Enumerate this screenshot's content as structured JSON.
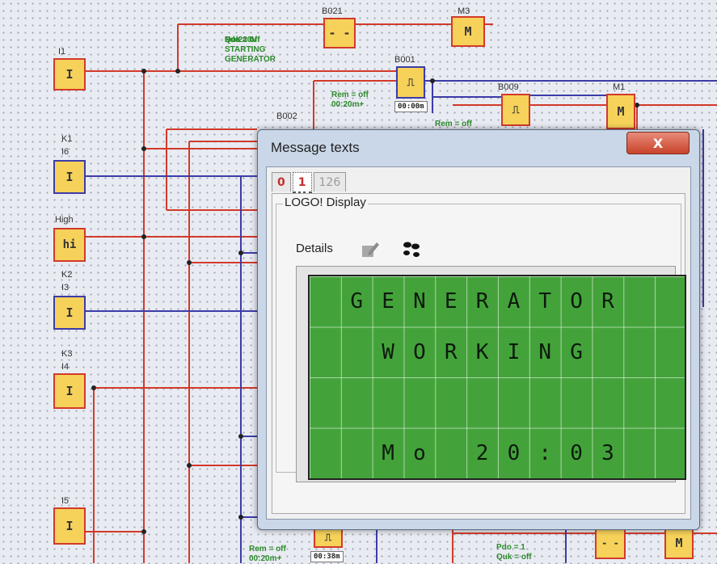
{
  "diagram": {
    "block_labels": {
      "b021": "B021",
      "m3": "M3",
      "b001": "B001",
      "b002": "B002",
      "b009": "B009",
      "m1": "M1",
      "i1": "I1",
      "k1": "K1",
      "i6": "I6",
      "high": "High",
      "k2": "K2",
      "i3": "I3",
      "k3": "K3",
      "i4": "I4",
      "i5": "I5"
    },
    "block_symbols": {
      "input": "I",
      "hi": "hi",
      "marker": "M",
      "and": "- -",
      "timer": "⎍"
    },
    "green_texts": [
      "Pdo = 0",
      "Quk = off",
      "No:220V",
      "STARTING",
      "GENERATOR"
    ],
    "param_texts": {
      "rem1": "Rem = off",
      "rem1_val": "00:20m+",
      "rem2": "Rem = off",
      "rem3": "Rem = off",
      "rem3_val": "00:20m+",
      "pdo2": "Pdo = 1",
      "quk2": "Quk = off"
    },
    "timer_values": {
      "b001": "00:00m",
      "bottom": "00:38m"
    }
  },
  "dialog": {
    "title": "Message texts",
    "close_label": "X",
    "tabs": [
      {
        "label": "0"
      },
      {
        "label": "1"
      },
      {
        "label": "126"
      }
    ],
    "group_title": "LOGO! Display",
    "details_label": "Details",
    "lcd_rows": [
      [
        "",
        "G",
        "E",
        "N",
        "E",
        "R",
        "A",
        "T",
        "O",
        "R",
        "",
        ""
      ],
      [
        "",
        "",
        "W",
        "O",
        "R",
        "K",
        "I",
        "N",
        "G",
        "",
        "",
        ""
      ],
      [
        "",
        "",
        "",
        "",
        "",
        "",
        "",
        "",
        "",
        "",
        "",
        ""
      ],
      [
        "",
        "",
        "M",
        "o",
        "",
        "2",
        "0",
        ":",
        "0",
        "3",
        "",
        ""
      ]
    ]
  },
  "colors": {
    "wire_red": "#d23a2a",
    "wire_blue": "#3c3ca8",
    "block_fill": "#f6d25a",
    "lcd_green": "#43a33a",
    "green_text": "#2c8a2c"
  }
}
